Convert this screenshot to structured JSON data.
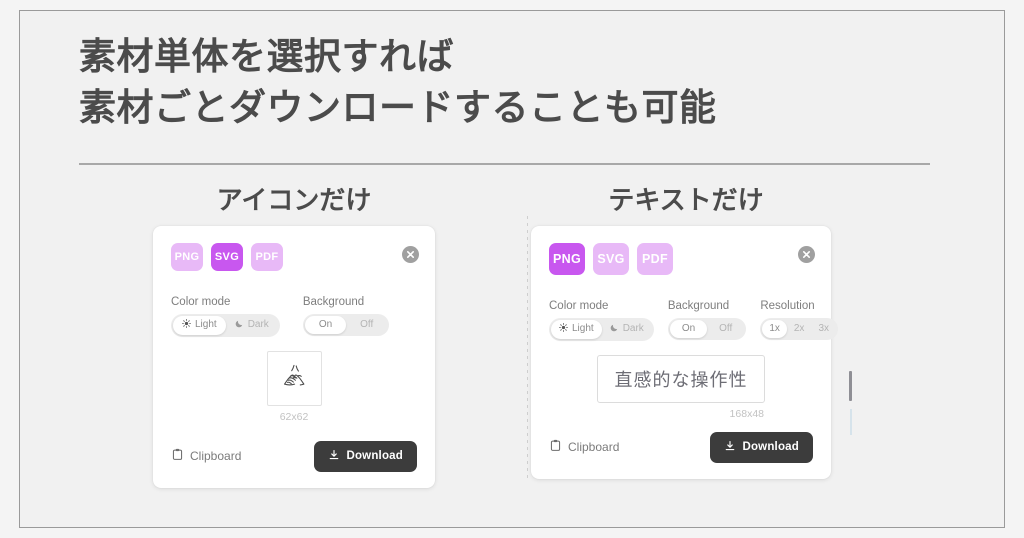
{
  "heading": {
    "line1": "素材単体を選択すれば",
    "line2": "素材ごとダウンロードすることも可能"
  },
  "colors": {
    "accent_selected": "#c857ef",
    "accent_unselected": "#e8b9f7",
    "download_button": "#3c3c3c",
    "page_background": "#f1f1f1",
    "frame_border": "#9a9a9a",
    "heading_text": "#4b4b4b"
  },
  "cards": {
    "left": {
      "heading": "アイコンだけ",
      "close_icon": "close-circle-icon",
      "formats": [
        {
          "label": "PNG",
          "selected": false
        },
        {
          "label": "SVG",
          "selected": true
        },
        {
          "label": "PDF",
          "selected": false
        }
      ],
      "controls": [
        {
          "label": "Color mode",
          "options": [
            {
              "label": "Light",
              "icon": "sun-icon",
              "selected": true
            },
            {
              "label": "Dark",
              "icon": "moon-icon",
              "selected": false
            }
          ]
        },
        {
          "label": "Background",
          "options": [
            {
              "label": "On",
              "icon": "",
              "selected": true
            },
            {
              "label": "Off",
              "icon": "",
              "selected": false
            }
          ]
        }
      ],
      "preview": {
        "type": "icon",
        "icon_name": "clasped-hands-icon",
        "dimensions": "62x62"
      },
      "footer": {
        "clipboard_label": "Clipboard",
        "clipboard_icon": "clipboard-icon",
        "download_label": "Download",
        "download_icon": "download-icon"
      }
    },
    "right": {
      "heading": "テキストだけ",
      "close_icon": "close-circle-icon",
      "formats": [
        {
          "label": "PNG",
          "selected": true
        },
        {
          "label": "SVG",
          "selected": false
        },
        {
          "label": "PDF",
          "selected": false
        }
      ],
      "controls": [
        {
          "label": "Color mode",
          "options": [
            {
              "label": "Light",
              "icon": "sun-icon",
              "selected": true
            },
            {
              "label": "Dark",
              "icon": "moon-icon",
              "selected": false
            }
          ]
        },
        {
          "label": "Background",
          "options": [
            {
              "label": "On",
              "icon": "",
              "selected": true
            },
            {
              "label": "Off",
              "icon": "",
              "selected": false
            }
          ]
        },
        {
          "label": "Resolution",
          "options": [
            {
              "label": "1x",
              "icon": "",
              "selected": true
            },
            {
              "label": "2x",
              "icon": "",
              "selected": false
            },
            {
              "label": "3x",
              "icon": "",
              "selected": false
            }
          ]
        }
      ],
      "preview": {
        "type": "text",
        "text": "直感的な操作性",
        "dimensions": "168x48"
      },
      "footer": {
        "clipboard_label": "Clipboard",
        "clipboard_icon": "clipboard-icon",
        "download_label": "Download",
        "download_icon": "download-icon"
      }
    }
  }
}
